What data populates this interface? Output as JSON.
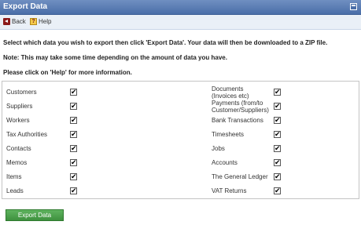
{
  "window": {
    "title": "Export Data"
  },
  "toolbar": {
    "back_label": "Back",
    "help_label": "Help"
  },
  "intro": {
    "line1": "Select which data you wish to export then click 'Export Data'. Your data will then be downloaded to a ZIP file.",
    "line2": "Note: This may take some time depending on the amount of data you have.",
    "line3": "Please click on 'Help' for more information."
  },
  "left_items": [
    {
      "label": "Customers",
      "checked": true
    },
    {
      "label": "Suppliers",
      "checked": true
    },
    {
      "label": "Workers",
      "checked": true
    },
    {
      "label": "Tax Authorities",
      "checked": true
    },
    {
      "label": "Contacts",
      "checked": true
    },
    {
      "label": "Memos",
      "checked": true
    },
    {
      "label": "Items",
      "checked": true
    },
    {
      "label": "Leads",
      "checked": true
    }
  ],
  "right_items": [
    {
      "label": "Documents (Invoices etc)",
      "line1": "Documents",
      "line2": "(Invoices etc)",
      "checked": true
    },
    {
      "label": "Payments (from/to Customer/Suppliers)",
      "line1": "Payments (from/to",
      "line2": "Customer/Suppliers)",
      "checked": true
    },
    {
      "label": "Bank Transactions",
      "checked": true
    },
    {
      "label": "Timesheets",
      "checked": true
    },
    {
      "label": "Jobs",
      "checked": true
    },
    {
      "label": "Accounts",
      "checked": true
    },
    {
      "label": "The General Ledger",
      "checked": true
    },
    {
      "label": "VAT Returns",
      "checked": true
    }
  ],
  "actions": {
    "export_label": "Export Data"
  },
  "colors": {
    "titlebar": "#4a6ea8",
    "button": "#3e913e"
  }
}
